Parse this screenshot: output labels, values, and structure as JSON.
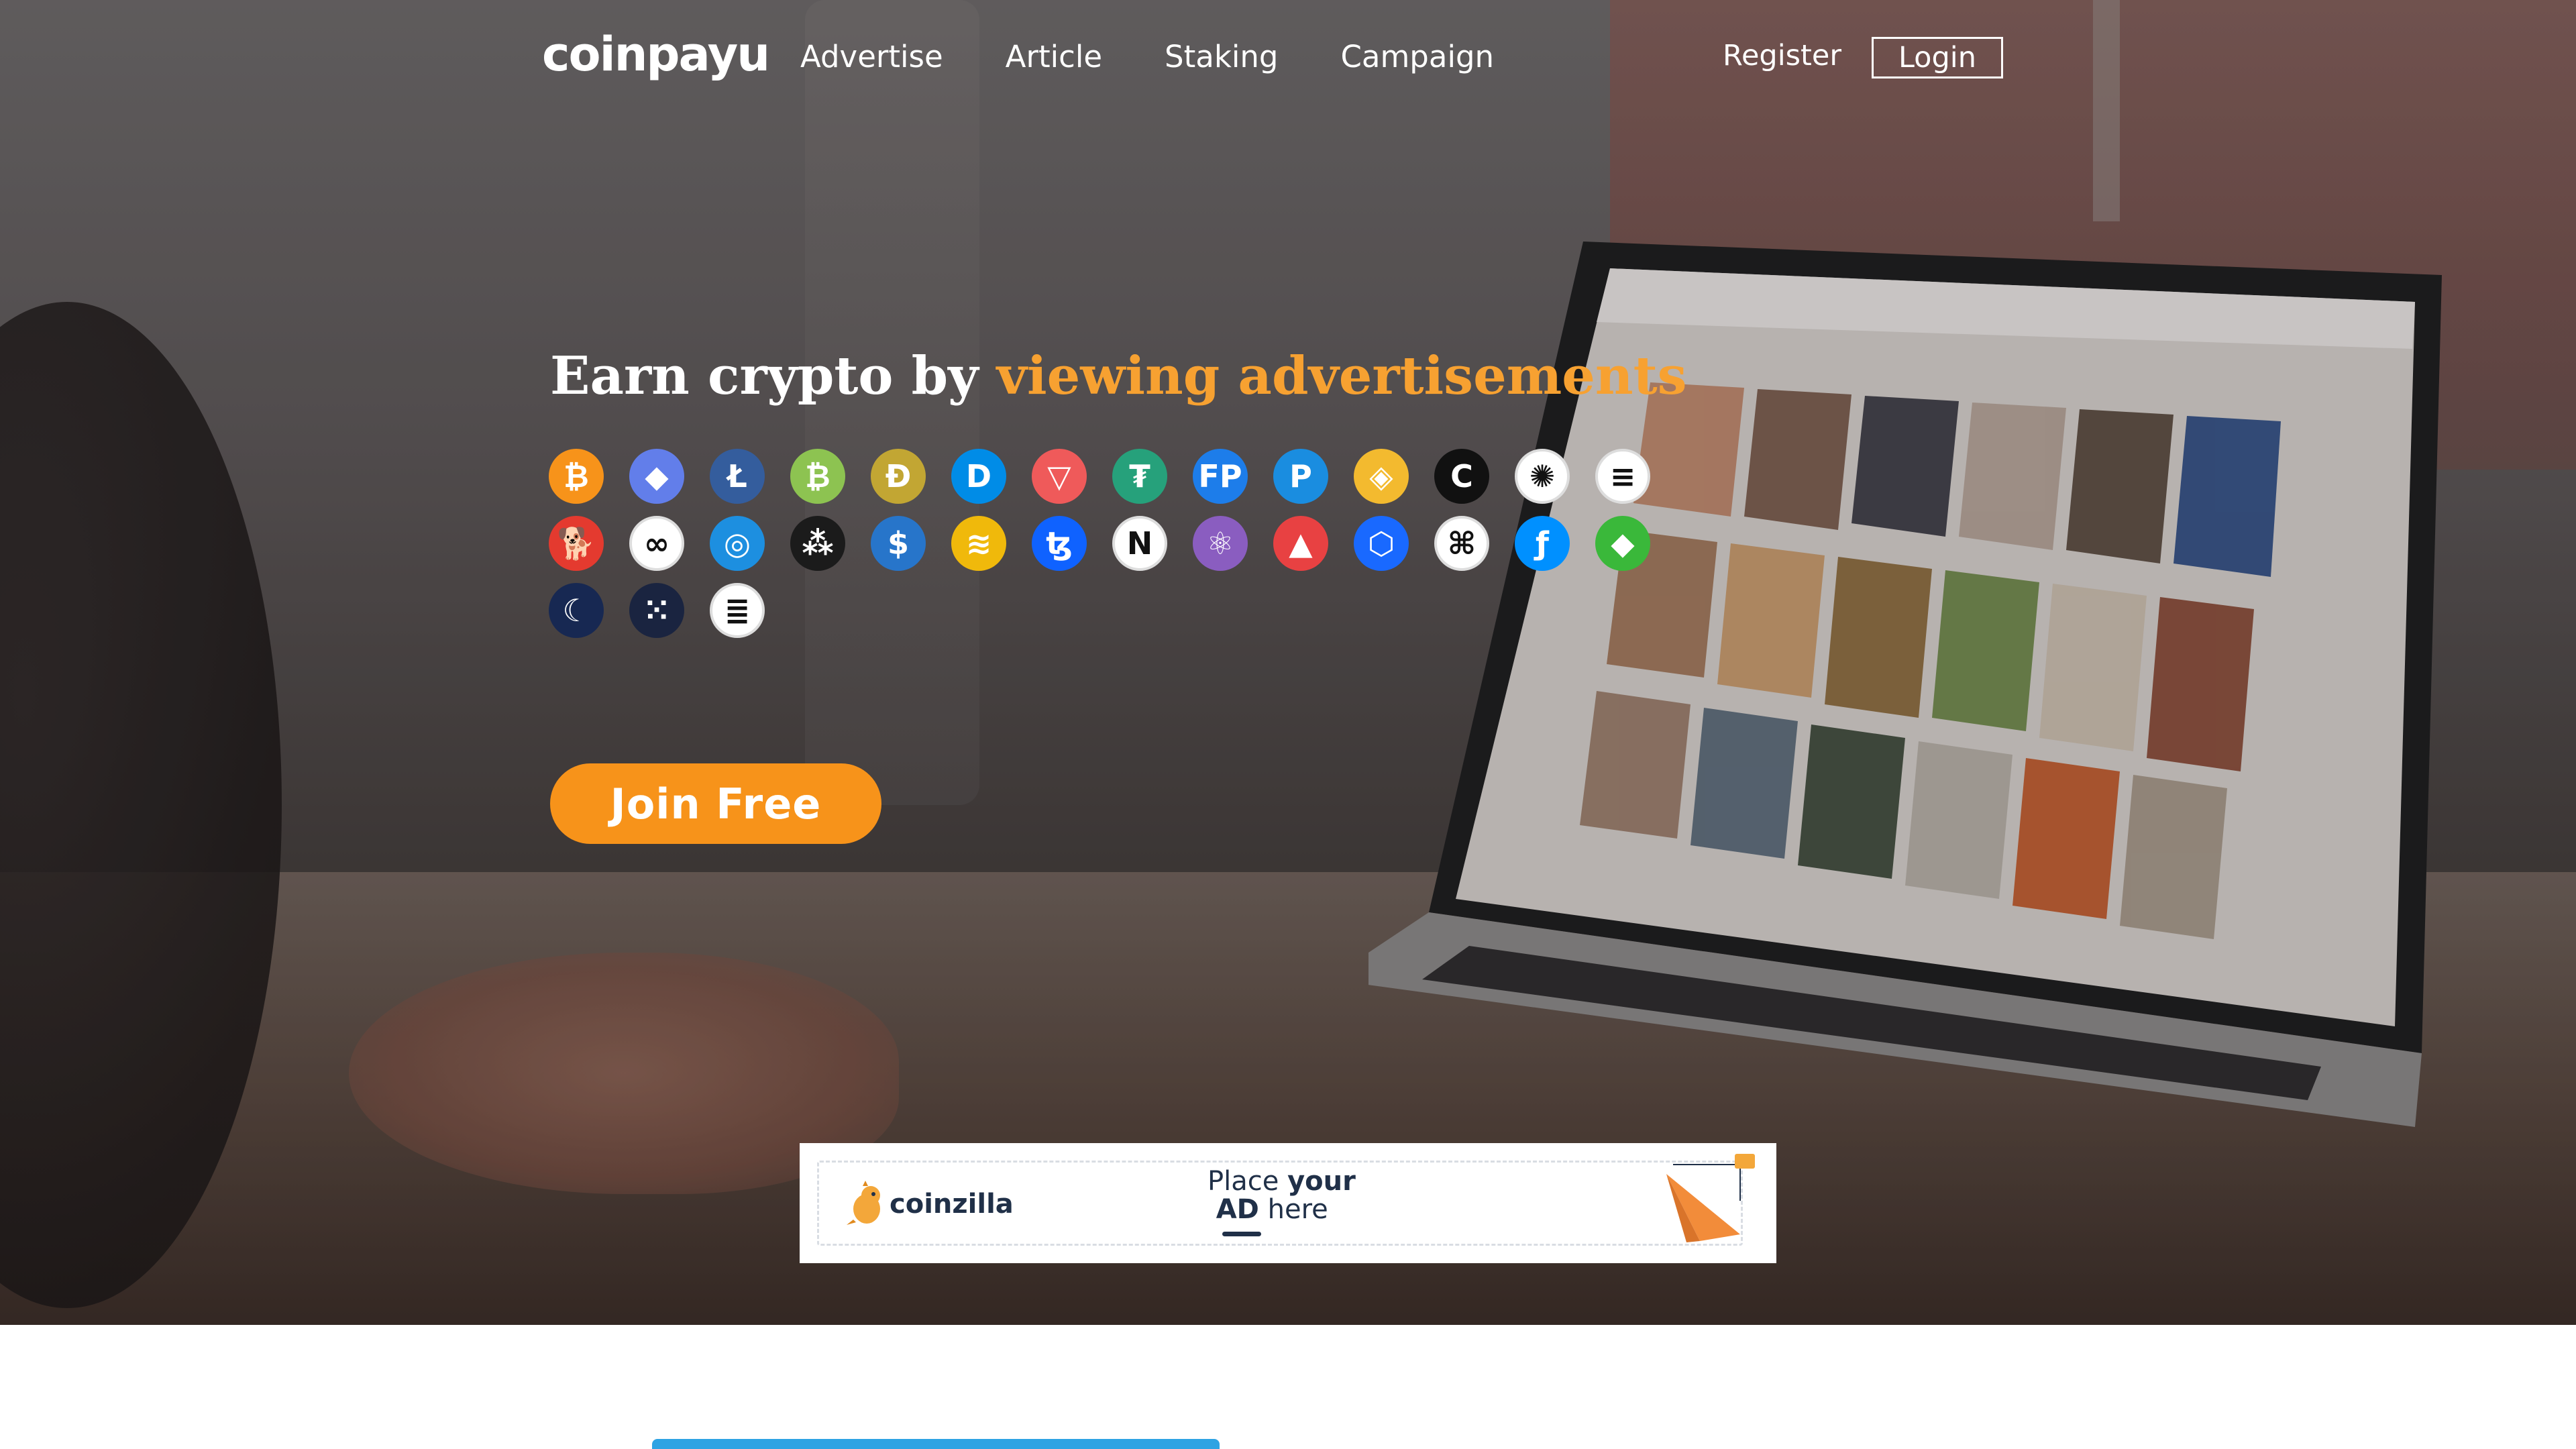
{
  "header": {
    "logo_text": "coinpayu",
    "nav": [
      "Advertise",
      "Article",
      "Staking",
      "Campaign"
    ],
    "register_label": "Register",
    "login_label": "Login"
  },
  "hero": {
    "headline_prefix": "Earn crypto by",
    "headline_accent": "viewing advertisements",
    "accent_color": "#f7a131",
    "cta_label": "Join Free",
    "cta_color": "#f7931a"
  },
  "coins": [
    {
      "icon": "bitcoin-icon",
      "glyph": "₿",
      "bg": "#f7931a"
    },
    {
      "icon": "ethereum-icon",
      "glyph": "◆",
      "bg": "#627eea"
    },
    {
      "icon": "litecoin-icon",
      "glyph": "Ł",
      "bg": "#345d9d"
    },
    {
      "icon": "bitcoin-cash-icon",
      "glyph": "₿",
      "bg": "#8dc351"
    },
    {
      "icon": "dogecoin-icon",
      "glyph": "Ð",
      "bg": "#c2a633"
    },
    {
      "icon": "dash-icon",
      "glyph": "D",
      "bg": "#008ce7"
    },
    {
      "icon": "tron-icon",
      "glyph": "▽",
      "bg": "#ef5a5a"
    },
    {
      "icon": "tether-icon",
      "glyph": "₮",
      "bg": "#26a17b"
    },
    {
      "icon": "faucetpay-icon",
      "glyph": "FP",
      "bg": "#1d7dea"
    },
    {
      "icon": "payeer-icon",
      "glyph": "P",
      "bg": "#1a8de0"
    },
    {
      "icon": "bnb-icon",
      "glyph": "◈",
      "bg": "#f3ba2f"
    },
    {
      "icon": "bittorrent-icon",
      "glyph": "C",
      "bg": "#111111"
    },
    {
      "icon": "cardano-icon",
      "glyph": "✺",
      "bg": "#ffffff"
    },
    {
      "icon": "solana-icon",
      "glyph": "≡",
      "bg": "#ffffff"
    },
    {
      "icon": "shiba-inu-icon",
      "glyph": "🐕",
      "bg": "#e43a2f"
    },
    {
      "icon": "polygon-icon",
      "glyph": "∞",
      "bg": "#ffffff"
    },
    {
      "icon": "zilliqa-icon",
      "glyph": "◎",
      "bg": "#1d8fe0"
    },
    {
      "icon": "iota-icon",
      "glyph": "⁂",
      "bg": "#1b1b1b"
    },
    {
      "icon": "usdc-icon",
      "glyph": "$",
      "bg": "#2775ca"
    },
    {
      "icon": "binance-usd-icon",
      "glyph": "≋",
      "bg": "#f0b90b"
    },
    {
      "icon": "tezos-icon",
      "glyph": "ꜩ",
      "bg": "#0f62ff"
    },
    {
      "icon": "near-icon",
      "glyph": "N",
      "bg": "#ffffff"
    },
    {
      "icon": "cosmos-icon",
      "glyph": "⚛",
      "bg": "#8a5dc0"
    },
    {
      "icon": "avalanche-icon",
      "glyph": "▲",
      "bg": "#e84142"
    },
    {
      "icon": "fantom-icon",
      "glyph": "⬡",
      "bg": "#1969ff"
    },
    {
      "icon": "harmony-icon",
      "glyph": "⌘",
      "bg": "#ffffff"
    },
    {
      "icon": "filecoin-icon",
      "glyph": "ƒ",
      "bg": "#0090ff"
    },
    {
      "icon": "ethereum-classic-icon",
      "glyph": "◆",
      "bg": "#3ab83a"
    },
    {
      "icon": "terra-luna-icon",
      "glyph": "☾",
      "bg": "#172852"
    },
    {
      "icon": "dots-icon",
      "glyph": "⁙",
      "bg": "#1a2440"
    },
    {
      "icon": "us-flag-icon",
      "glyph": "≣",
      "bg": "#ffffff"
    }
  ],
  "ad_banner": {
    "brand": "coinzilla",
    "line1_normal": "Place ",
    "line1_bold": "your",
    "line2_bold": "AD",
    "line2_normal": " here"
  }
}
